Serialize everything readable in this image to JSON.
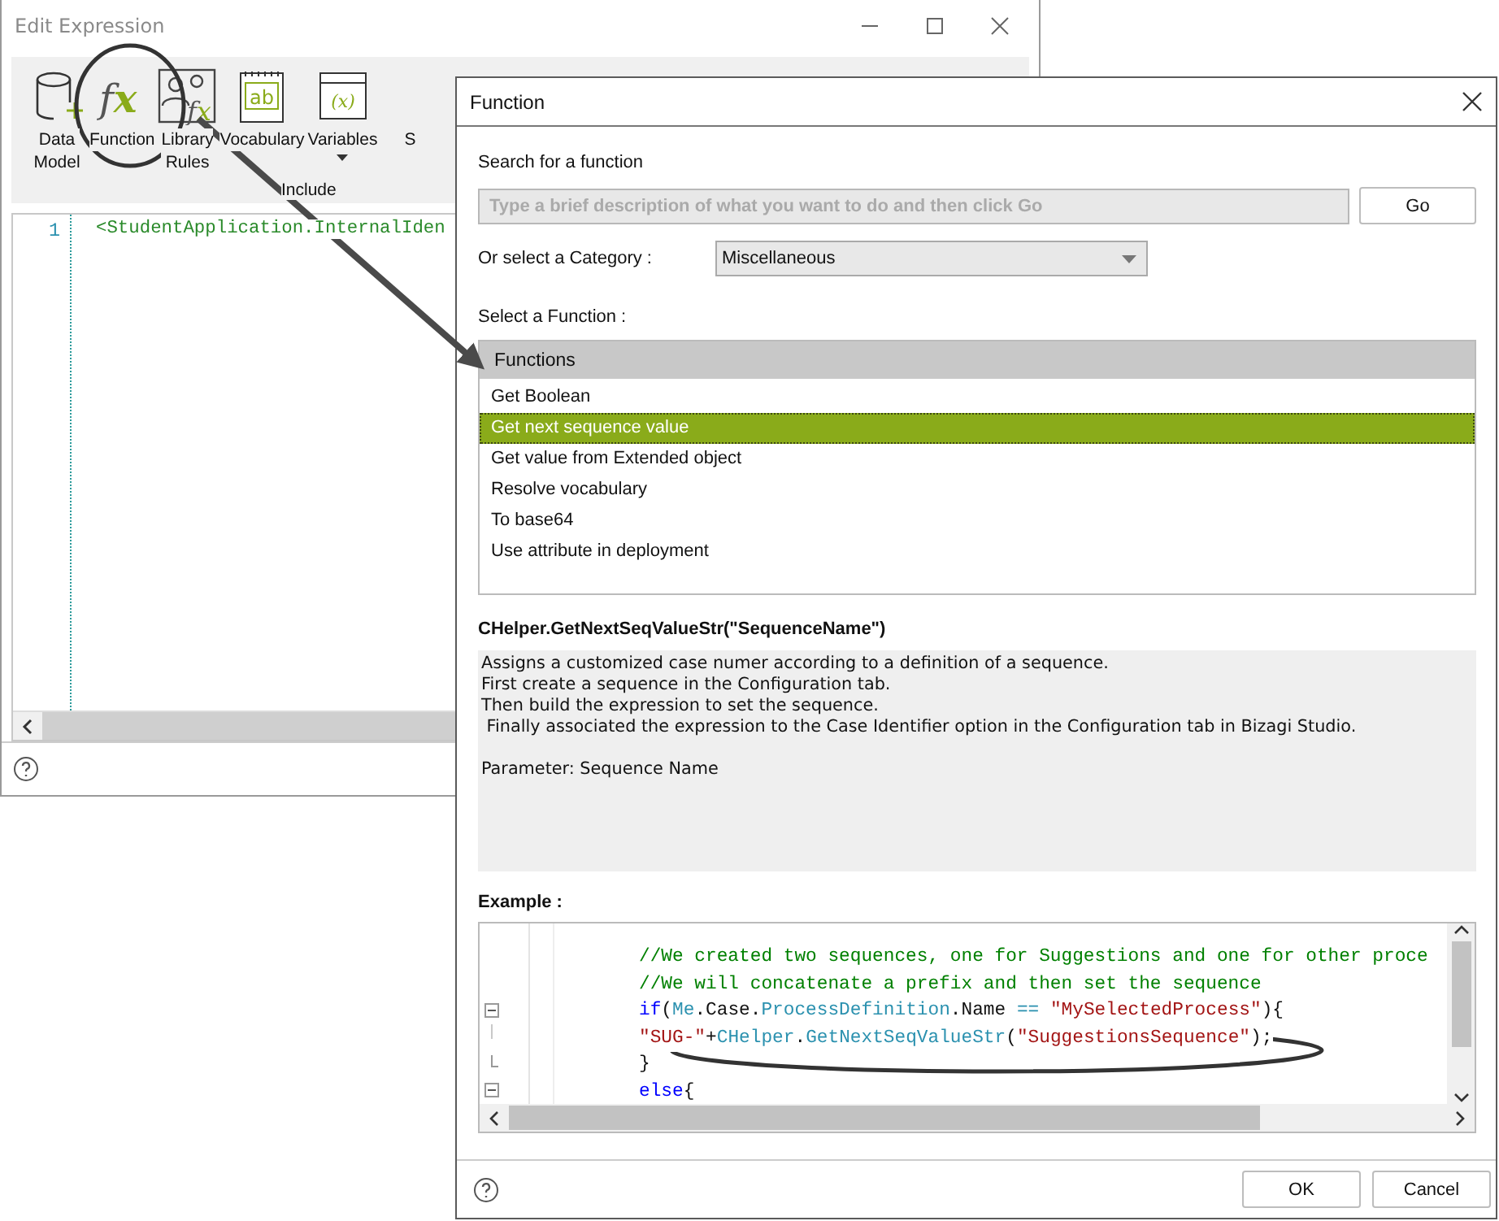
{
  "edit_window": {
    "title": "Edit Expression",
    "toolbar": {
      "items": [
        {
          "label": "Data Model",
          "kind": "database",
          "dropdown": false
        },
        {
          "label": "Function",
          "kind": "fx",
          "glyph": "fx",
          "dropdown": false
        },
        {
          "label": "Library Rules",
          "kind": "rules",
          "glyph": "fx",
          "dropdown": false
        },
        {
          "label": "Vocabulary",
          "kind": "notebook",
          "glyph": "ab",
          "dropdown": false
        },
        {
          "label": "Variables",
          "kind": "variable",
          "glyph": "(x)",
          "dropdown": true
        },
        {
          "label": "S",
          "kind": "blank",
          "dropdown": false
        }
      ],
      "group_label": "Include"
    },
    "editor": {
      "lines": [
        {
          "number": "1",
          "text": "<StudentApplication.InternalIden"
        }
      ]
    }
  },
  "function_dialog": {
    "title": "Function",
    "search": {
      "label": "Search for a function",
      "placeholder": "Type a brief description of what you want to do and then click Go",
      "button": "Go"
    },
    "category": {
      "label": "Or select a Category :",
      "value": "Miscellaneous"
    },
    "list_label": "Select a Function :",
    "list": {
      "header": "Functions",
      "items": [
        {
          "text": "Get Boolean",
          "selected": false
        },
        {
          "text": "Get next sequence value",
          "selected": true
        },
        {
          "text": "Get value from Extended object",
          "selected": false
        },
        {
          "text": "Resolve vocabulary",
          "selected": false
        },
        {
          "text": "To base64",
          "selected": false
        },
        {
          "text": "Use attribute in deployment",
          "selected": false
        }
      ]
    },
    "signature": "CHelper.GetNextSeqValueStr(\"SequenceName\")",
    "description": {
      "lines": [
        "Assigns a customized case numer according to a definition of a sequence.",
        "First create a sequence in the Configuration tab.",
        "Then build the expression to set the sequence.",
        " Finally associated the expression to the Case Identifier option in the Configuration tab in Bizagi Studio."
      ],
      "parameter": "Parameter: Sequence Name"
    },
    "example_label": "Example :",
    "example_lines": [
      {
        "kind": "plain",
        "tokens": [
          {
            "kind": "comment",
            "text": "//We created two sequences, one for Suggestions and one for other proce"
          }
        ]
      },
      {
        "kind": "plain",
        "tokens": [
          {
            "kind": "comment",
            "text": "//We will concatenate a prefix and then set the sequence"
          }
        ]
      },
      {
        "kind": "fold_open",
        "tokens": [
          {
            "kind": "keyword",
            "text": "if"
          },
          {
            "kind": "plain",
            "text": "("
          },
          {
            "kind": "ident",
            "text": "Me"
          },
          {
            "kind": "plain",
            "text": ".Case."
          },
          {
            "kind": "ident",
            "text": "ProcessDefinition"
          },
          {
            "kind": "plain",
            "text": ".Name "
          },
          {
            "kind": "ident",
            "text": "=="
          },
          {
            "kind": "string",
            "text": " \"MySelectedProcess\""
          },
          {
            "kind": "plain",
            "text": "){"
          }
        ]
      },
      {
        "kind": "fold_inner",
        "tokens": [
          {
            "kind": "string",
            "text": "\"SUG-\""
          },
          {
            "kind": "plain",
            "text": "+"
          },
          {
            "kind": "ident",
            "text": "CHelper"
          },
          {
            "kind": "plain",
            "text": "."
          },
          {
            "kind": "ident",
            "text": "GetNextSeqValueStr"
          },
          {
            "kind": "plain",
            "text": "("
          },
          {
            "kind": "string",
            "text": "\"SuggestionsSequence\""
          },
          {
            "kind": "plain",
            "text": ");"
          }
        ]
      },
      {
        "kind": "fold_end",
        "tokens": [
          {
            "kind": "plain",
            "text": "}"
          }
        ]
      },
      {
        "kind": "fold_open",
        "tokens": [
          {
            "kind": "keyword",
            "text": "else"
          },
          {
            "kind": "plain",
            "text": "{"
          }
        ]
      }
    ],
    "buttons": [
      "OK",
      "Cancel"
    ]
  }
}
